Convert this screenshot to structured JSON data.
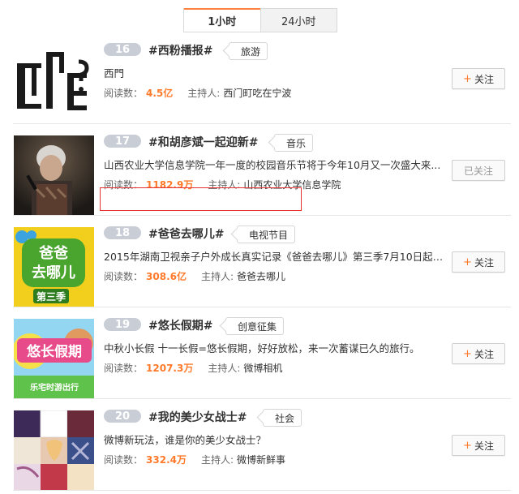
{
  "tabs": [
    {
      "label": "1小时",
      "active": true
    },
    {
      "label": "24小时",
      "active": false
    }
  ],
  "read_label": "阅读数：",
  "host_label": "主持人:",
  "items": [
    {
      "rank": "16",
      "title": "#西粉播报#",
      "tag": "旅游",
      "desc": "西門",
      "reads": "4.5亿",
      "host": "西门町吃在宁波",
      "follow_label": "关注",
      "followed": false,
      "thumb_icon": "ximending-logo"
    },
    {
      "rank": "17",
      "title": "#和胡彦斌一起迎新#",
      "tag": "音乐",
      "desc": "山西农业大学信息学院一年一度的校园音乐节将于今年10月又一次盛大来...",
      "reads": "1182.9万",
      "host": "山西农业大学信息学院",
      "follow_label": "已关注",
      "followed": true,
      "thumb_icon": "singer-photo"
    },
    {
      "rank": "18",
      "title": "#爸爸去哪儿#",
      "tag": "电视节目",
      "desc": "2015年湖南卫视亲子户外成长真实记录《爸爸去哪儿》第三季7月10日起每...",
      "reads": "308.6亿",
      "host": "爸爸去哪儿",
      "follow_label": "关注",
      "followed": false,
      "thumb_icon": "show-logo"
    },
    {
      "rank": "19",
      "title": "#悠长假期#",
      "tag": "创意征集",
      "desc": "中秋小长假 十一长假=悠长假期，好好放松，来一次蓄谋已久的旅行。",
      "reads": "1207.3万",
      "host": "微博相机",
      "follow_label": "关注",
      "followed": false,
      "thumb_icon": "holiday-poster"
    },
    {
      "rank": "20",
      "title": "#我的美少女战士#",
      "tag": "社会",
      "desc": "微博新玩法，谁是你的美少女战士？",
      "reads": "332.4万",
      "host": "微博新鲜事",
      "follow_label": "关注",
      "followed": false,
      "thumb_icon": "anime-collage"
    }
  ],
  "thumb_text": {
    "logo_a": "西",
    "logo_b": "门",
    "logo_c": "町",
    "show_a": "爸爸",
    "show_b": "去哪儿",
    "show_c": "第三季",
    "holiday_a": "悠长假期",
    "holiday_b": "乐宅时游出行"
  }
}
